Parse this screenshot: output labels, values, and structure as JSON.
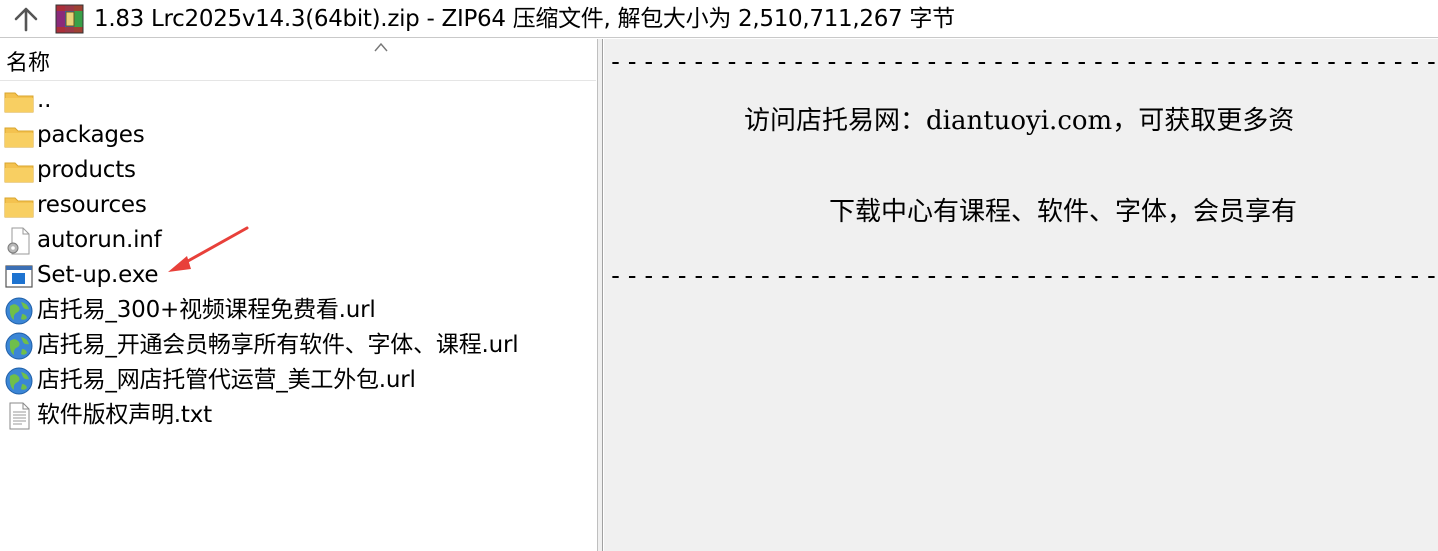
{
  "addressbar": {
    "title": "1.83 Lrc2025v14.3(64bit).zip - ZIP64 压缩文件, 解包大小为 2,510,711,267 字节",
    "up_icon": "up-arrow-icon",
    "archive_icon": "winrar-archive-icon"
  },
  "filelist": {
    "column_name": "名称",
    "sort_icon": "sort-ascending-icon",
    "items": [
      {
        "name": "..",
        "icon": "folder-icon"
      },
      {
        "name": "packages",
        "icon": "folder-icon"
      },
      {
        "name": "products",
        "icon": "folder-icon"
      },
      {
        "name": "resources",
        "icon": "folder-icon"
      },
      {
        "name": "autorun.inf",
        "icon": "settings-file-icon"
      },
      {
        "name": "Set-up.exe",
        "icon": "exe-icon"
      },
      {
        "name": "店托易_300+视频课程免费看.url",
        "icon": "globe-icon"
      },
      {
        "name": "店托易_开通会员畅享所有软件、字体、课程.url",
        "icon": "globe-icon"
      },
      {
        "name": "店托易_网店托管代运营_美工外包.url",
        "icon": "globe-icon"
      },
      {
        "name": "软件版权声明.txt",
        "icon": "text-file-icon"
      }
    ]
  },
  "preview": {
    "dash_line": "------------------------------------------------------------------",
    "line1": "访问店托易网：diantuoyi.com，可获取更多资",
    "line2": "下载中心有课程、软件、字体，会员享有"
  },
  "colors": {
    "folder": "#f4c24f",
    "arrow": "#e8403a",
    "preview_bg": "#f0f0f0"
  }
}
